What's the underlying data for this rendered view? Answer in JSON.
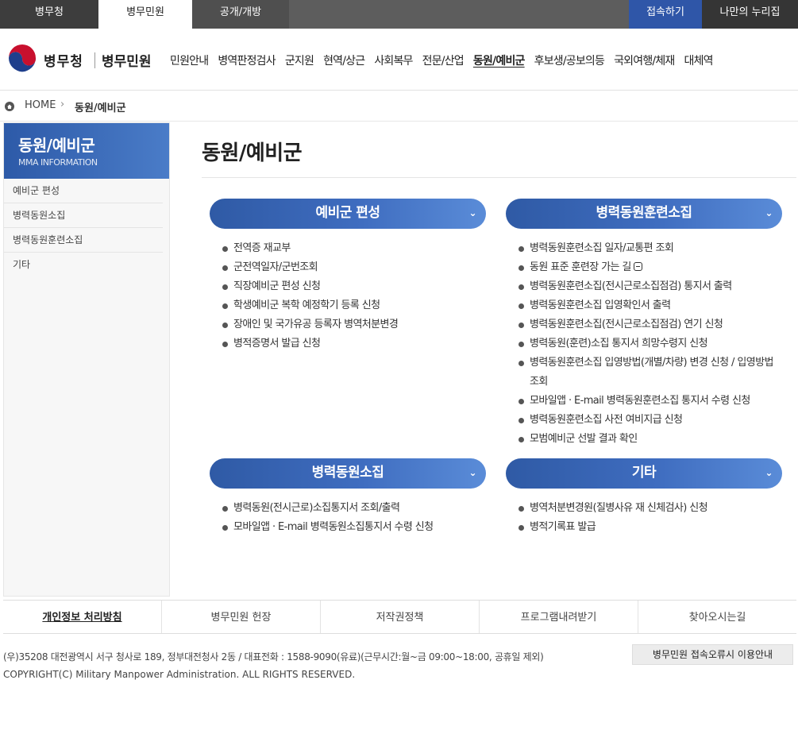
{
  "topbar": {
    "tab_mma": "병무청",
    "tab_minwon": "병무민원",
    "tab_open": "공개/개방",
    "login": "접속하기",
    "my": "나만의 누리집"
  },
  "header": {
    "brand": "병무청",
    "brand_sub": "병무민원",
    "gnb": [
      "민원안내",
      "병역판정검사",
      "군지원",
      "현역/상근",
      "사회복무",
      "전문/산업",
      "동원/예비군",
      "후보생/공보의등",
      "국외여행/체재",
      "대체역"
    ],
    "active_index": 6
  },
  "breadcrumb": {
    "home": "HOME",
    "current": "동원/예비군"
  },
  "sidebar": {
    "title": "동원/예비군",
    "subtitle": "MMA INFORMATION",
    "items": [
      "예비군 편성",
      "병력동원소집",
      "병력동원훈련소집",
      "기타"
    ]
  },
  "page_title": "동원/예비군",
  "sections": {
    "reserve": {
      "title": "예비군 편성",
      "items": [
        "전역증 재교부",
        "군전역일자/군번조회",
        "직장예비군 편성 신청",
        "학생예비군 복학 예정학기 등록 신청",
        "장애인 및 국가유공 등록자 병역처분변경",
        "병적증명서 발급 신청"
      ]
    },
    "training": {
      "title": "병력동원훈련소집",
      "items": [
        "병력동원훈련소집 일자/교통편 조회",
        "동원 표준 훈련장 가는 길",
        "병력동원훈련소집(전시근로소집점검) 통지서 출력",
        "병력동원훈련소집 입영확인서 출력",
        "병력동원훈련소집(전시근로소집점검) 연기 신청",
        "병력동원(훈련)소집 통지서 희망수령지 신청",
        "병력동원훈련소집 입영방법(개별/차량) 변경 신청 / 입영방법 조회",
        "모바일앱 · E-mail 병력동원훈련소집 통지서 수령 신청",
        "병력동원훈련소집 사전 여비지급 신청",
        "모범예비군 선발 결과 확인"
      ]
    },
    "mobilization": {
      "title": "병력동원소집",
      "items": [
        "병력동원(전시근로)소집통지서 조회/출력",
        "모바일앱 · E-mail 병력동원소집통지서 수령 신청"
      ]
    },
    "etc": {
      "title": "기타",
      "items": [
        "병역처분변경원(질병사유 재 신체검사) 신청",
        "병적기록표 발급"
      ]
    }
  },
  "footer": {
    "links": [
      "개인정보 처리방침",
      "병무민원 헌장",
      "저작권정책",
      "프로그램내려받기",
      "찾아오시는길"
    ],
    "address": "(우)35208 대전광역시 서구 청사로 189, 정부대전청사 2동 / 대표전화 : 1588-9090(유료)(근무시간:월~금 09:00~18:00, 공휴일 제외)",
    "copyright": "COPYRIGHT(C) Military Manpower Administration. ALL RIGHTS RESERVED.",
    "error_button": "병무민원 접속오류시 이용안내"
  },
  "colors": {
    "accent": "#2f5aa5",
    "topbar": "#5d5d5d",
    "login_bg": "#2f56a8"
  }
}
